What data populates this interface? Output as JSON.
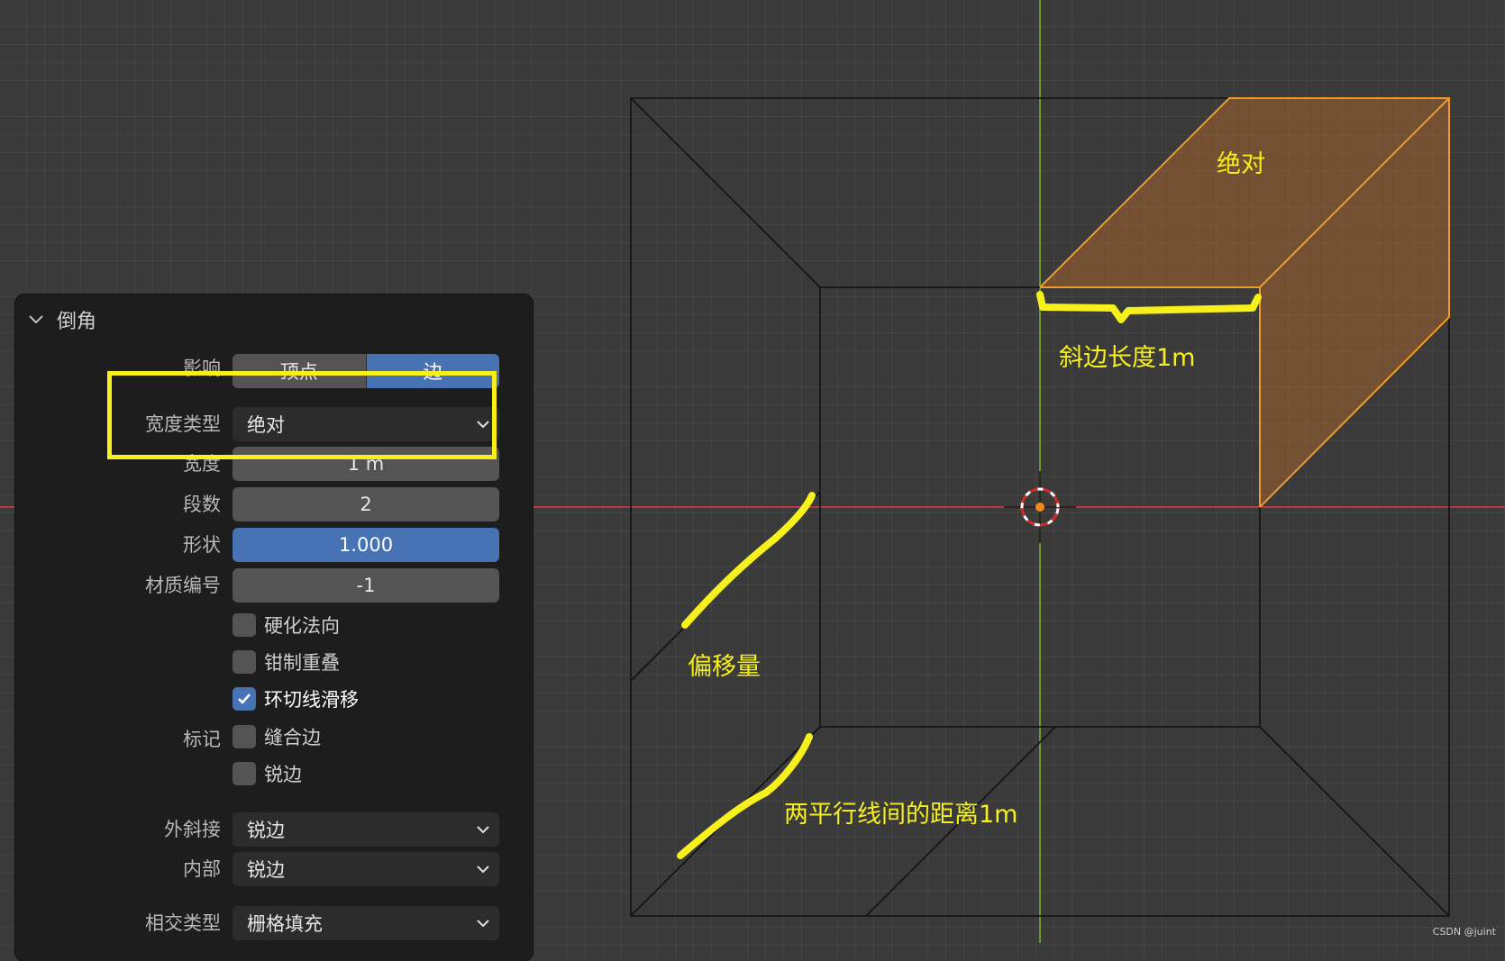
{
  "panel": {
    "title": "倒角",
    "affect": {
      "label": "影响",
      "options": [
        "顶点",
        "边"
      ],
      "selected": "边"
    },
    "width_type": {
      "label": "宽度类型",
      "value": "绝对"
    },
    "width": {
      "label": "宽度",
      "value": "1 m"
    },
    "segments": {
      "label": "段数",
      "value": "2"
    },
    "shape": {
      "label": "形状",
      "value": "1.000"
    },
    "material_index": {
      "label": "材质编号",
      "value": "-1"
    },
    "harden_normals": {
      "label": "硬化法向",
      "checked": false
    },
    "clamp_overlap": {
      "label": "钳制重叠",
      "checked": false
    },
    "loop_slide": {
      "label": "环切线滑移",
      "checked": true
    },
    "mark": {
      "label": "标记",
      "seam": {
        "label": "缝合边",
        "checked": false
      },
      "sharp": {
        "label": "锐边",
        "checked": false
      }
    },
    "miter_outer": {
      "label": "外斜接",
      "value": "锐边"
    },
    "inner": {
      "label": "内部",
      "value": "锐边"
    },
    "intersection_type": {
      "label": "相交类型",
      "value": "栅格填充"
    }
  },
  "annotations": {
    "absolute": "绝对",
    "bevel_length": "斜边长度1m",
    "offset": "偏移量",
    "parallel_distance": "两平行线间的距离1m"
  },
  "watermark": "CSDN @juint",
  "colors": {
    "annotation_yellow": "#f6f01c",
    "accent_blue": "#4772b3",
    "selection_orange": "#e8902a",
    "axis_red": "#c0393f",
    "axis_green": "#6b9a2e"
  }
}
